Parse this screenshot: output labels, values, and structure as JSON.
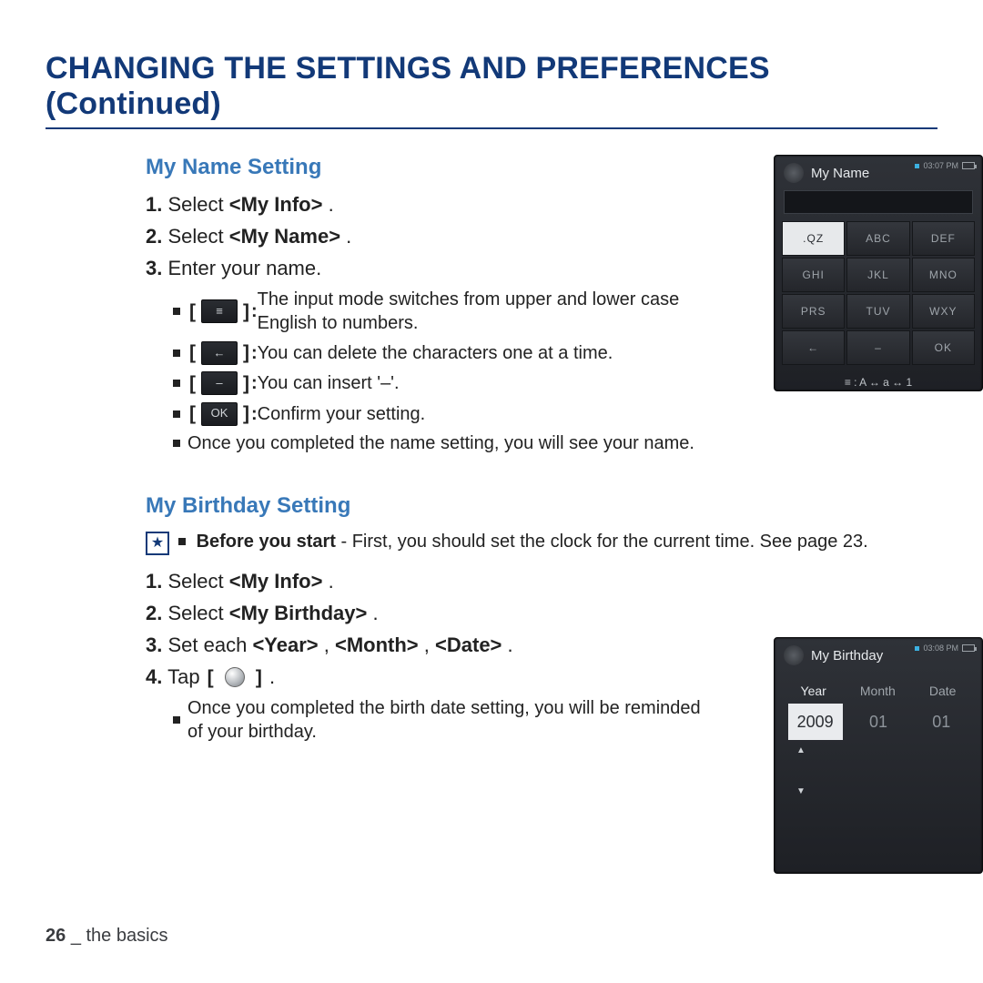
{
  "page_title": "CHANGING THE SETTINGS AND PREFERENCES (Continued)",
  "name_section": {
    "title": "My Name Setting",
    "steps": {
      "s1_bold": "1.",
      "s1_pre": " Select ",
      "s1_b": "<My Info>",
      "s1_post": ".",
      "s2_bold": "2.",
      "s2_pre": " Select ",
      "s2_b": "<My Name>",
      "s2_post": ".",
      "s3_bold": "3.",
      "s3_text": " Enter your name."
    },
    "bullets": {
      "mode_key": "≡",
      "mode_text": "The input mode switches from upper and lower case English to numbers.",
      "del_key": "←",
      "del_text": "You can delete the characters one at a time.",
      "dash_key": "–",
      "dash_text": "You can insert '–'.",
      "ok_key": "OK",
      "ok_text": "Confirm your setting.",
      "done_text": "Once you completed the name setting, you will see your name."
    }
  },
  "bday_section": {
    "title": "My Birthday Setting",
    "before_bold": "Before you start",
    "before_text": " - First, you should set the clock for the current time. See page 23.",
    "steps": {
      "s1_bold": "1.",
      "s1_pre": " Select ",
      "s1_b": "<My Info>",
      "s1_post": ".",
      "s2_bold": "2.",
      "s2_pre": " Select ",
      "s2_b": "<My Birthday>",
      "s2_post": ".",
      "s3_bold": "3.",
      "s3_pre": " Set each ",
      "s3_b1": "<Year>",
      "s3_c1": ", ",
      "s3_b2": "<Month>",
      "s3_c2": ", ",
      "s3_b3": "<Date>",
      "s3_post": ".",
      "s4_bold": "4.",
      "s4_pre": " Tap ",
      "s4_post": "."
    },
    "bullet_done": "Once you completed the birth date setting, you will be reminded of your birthday."
  },
  "phone_name": {
    "status_time": "03:07 PM",
    "title": "My Name",
    "keys": {
      "k1": ".QZ",
      "k2": "ABC",
      "k3": "DEF",
      "k4": "GHI",
      "k5": "JKL",
      "k6": "MNO",
      "k7": "PRS",
      "k8": "TUV",
      "k9": "WXY",
      "k10": "←",
      "k11": "–",
      "k12": "OK"
    },
    "mode": "≡  : A  ↔  a  ↔  1"
  },
  "phone_bday": {
    "status_time": "03:08 PM",
    "title": "My Birthday",
    "tab_year": "Year",
    "tab_month": "Month",
    "tab_date": "Date",
    "val_year": "2009",
    "val_month": "01",
    "val_date": "01",
    "arr_up": "▲",
    "arr_dn": "▼"
  },
  "footer": {
    "page": "26",
    "sep": " _ ",
    "chapter": "the basics"
  },
  "brackets": {
    "l": "[",
    "r": "]",
    "colon": " : "
  }
}
